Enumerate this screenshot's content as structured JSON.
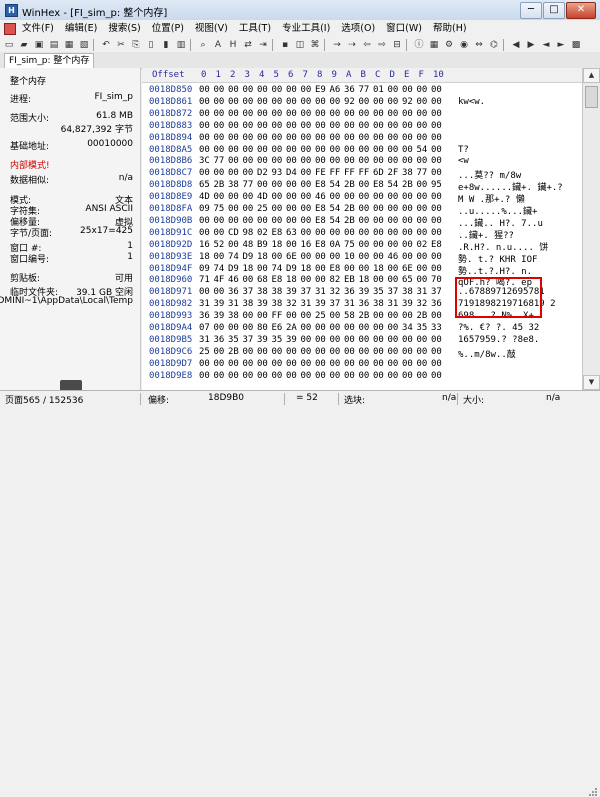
{
  "window": {
    "title": "WinHex - [FI_sim_p: 整个内存]",
    "app_icon": "H",
    "buttons": [
      "─",
      "□",
      "✕"
    ]
  },
  "menu": [
    "文件(F)",
    "编辑(E)",
    "搜索(S)",
    "位置(P)",
    "视图(V)",
    "工具(T)",
    "专业工具(I)",
    "选项(O)",
    "窗口(W)",
    "帮助(H)"
  ],
  "tabs": [
    "FI_sim_p: 整个内存"
  ],
  "panel": {
    "heading": "整个内存",
    "rows": [
      {
        "label": "进程:",
        "value": "FI_sim_p"
      },
      {
        "label": "范围大小:",
        "value": "61.8 MB"
      },
      {
        "label": "",
        "value": "64,827,392 字节"
      },
      {
        "label": "基础地址:",
        "value": "00010000"
      },
      {
        "label": "内部模式!",
        "value": ""
      },
      {
        "label": "数据相似:",
        "value": "n/a"
      },
      {
        "label": "模式:",
        "value": "文本"
      },
      {
        "label": "字符集:",
        "value": "ANSI ASCII"
      },
      {
        "label": "偏移量:",
        "value": "虚拟"
      },
      {
        "label": "字节/页面:",
        "value": "25x17=425"
      },
      {
        "label": "窗口 #:",
        "value": "1"
      },
      {
        "label": "窗口编号:",
        "value": "1"
      },
      {
        "label": "剪贴板:",
        "value": "可用"
      },
      {
        "label": "临时文件夹:",
        "value": "39.1 GB 空闲"
      },
      {
        "label": "",
        "value": "\\ADMINI~1\\AppData\\Local\\Temp"
      }
    ]
  },
  "hex": {
    "offset_label": "Offset",
    "columns": [
      "0",
      "1",
      "2",
      "3",
      "4",
      "5",
      "6",
      "7",
      "8",
      "9",
      "A",
      "B",
      "C",
      "D",
      "E",
      "F",
      "10"
    ],
    "rows": [
      {
        "offset": "0018D850",
        "bytes": [
          "00",
          "00",
          "00",
          "00",
          "00",
          "00",
          "00",
          "00",
          "E9",
          "A6",
          "36",
          "77",
          "01",
          "00",
          "00",
          "00",
          "00"
        ],
        "text": ""
      },
      {
        "offset": "0018D861",
        "bytes": [
          "00",
          "00",
          "00",
          "00",
          "00",
          "00",
          "00",
          "00",
          "00",
          "00",
          "92",
          "00",
          "00",
          "00",
          "92",
          "00",
          "00"
        ],
        "text": "   kw<w."
      },
      {
        "offset": "0018D872",
        "bytes": [
          "00",
          "00",
          "00",
          "00",
          "00",
          "00",
          "00",
          "00",
          "00",
          "00",
          "00",
          "00",
          "00",
          "00",
          "00",
          "00",
          "00"
        ],
        "text": ""
      },
      {
        "offset": "0018D883",
        "bytes": [
          "00",
          "00",
          "00",
          "00",
          "00",
          "00",
          "00",
          "00",
          "00",
          "00",
          "00",
          "00",
          "00",
          "00",
          "00",
          "00",
          "00"
        ],
        "text": ""
      },
      {
        "offset": "0018D894",
        "bytes": [
          "00",
          "00",
          "00",
          "00",
          "00",
          "00",
          "00",
          "00",
          "00",
          "00",
          "00",
          "00",
          "00",
          "00",
          "00",
          "00",
          "00"
        ],
        "text": ""
      },
      {
        "offset": "0018D8A5",
        "bytes": [
          "00",
          "00",
          "00",
          "00",
          "00",
          "00",
          "00",
          "00",
          "00",
          "00",
          "00",
          "00",
          "00",
          "00",
          "00",
          "54",
          "00"
        ],
        "text": "T?"
      },
      {
        "offset": "0018D8B6",
        "bytes": [
          "3C",
          "77",
          "00",
          "00",
          "00",
          "00",
          "00",
          "00",
          "00",
          "00",
          "00",
          "00",
          "00",
          "00",
          "00",
          "00",
          "00"
        ],
        "text": "<w"
      },
      {
        "offset": "0018D8C7",
        "bytes": [
          "00",
          "00",
          "00",
          "00",
          "D2",
          "93",
          "D4",
          "00",
          "FE",
          "FF",
          "FF",
          "FF",
          "6D",
          "2F",
          "38",
          "77",
          "00"
        ],
        "text": "...莫??     m/8w"
      },
      {
        "offset": "0018D8D8",
        "bytes": [
          "65",
          "2B",
          "38",
          "77",
          "00",
          "00",
          "00",
          "00",
          "E8",
          "54",
          "2B",
          "00",
          "E8",
          "54",
          "2B",
          "00",
          "95",
          "00"
        ],
        "text": "e+8w......鑶+. 鑶+.?"
      },
      {
        "offset": "0018D8E9",
        "bytes": [
          "4D",
          "00",
          "00",
          "00",
          "4D",
          "00",
          "00",
          "00",
          "46",
          "00",
          "00",
          "00",
          "00",
          "00",
          "00",
          "00",
          "00"
        ],
        "text": "M   W    .那+.? 懶"
      },
      {
        "offset": "0018D8FA",
        "bytes": [
          "09",
          "75",
          "00",
          "00",
          "25",
          "00",
          "00",
          "00",
          "E8",
          "54",
          "2B",
          "00",
          "00",
          "00",
          "00",
          "00",
          "00"
        ],
        "text": "..u.....%...鑶+"
      },
      {
        "offset": "0018D90B",
        "bytes": [
          "00",
          "00",
          "00",
          "00",
          "00",
          "00",
          "00",
          "00",
          "E8",
          "54",
          "2B",
          "00",
          "00",
          "00",
          "00",
          "00",
          "00"
        ],
        "text": "...鑶.. H?.  7..u"
      },
      {
        "offset": "0018D91C",
        "bytes": [
          "00",
          "00",
          "CD",
          "98",
          "02",
          "E8",
          "63",
          "00",
          "00",
          "00",
          "00",
          "00",
          "00",
          "00",
          "00",
          "00",
          "00"
        ],
        "text": "..鑶+. 猩??"
      },
      {
        "offset": "0018D92D",
        "bytes": [
          "16",
          "52",
          "00",
          "48",
          "B9",
          "18",
          "00",
          "16",
          "E8",
          "0A",
          "75",
          "00",
          "00",
          "00",
          "00",
          "02",
          "E8"
        ],
        "text": ".R.H?. n.u....   饼"
      },
      {
        "offset": "0018D93E",
        "bytes": [
          "18",
          "00",
          "74",
          "D9",
          "18",
          "00",
          "6E",
          "00",
          "00",
          "00",
          "10",
          "00",
          "00",
          "46",
          "00",
          "00",
          "00"
        ],
        "text": "勢.  t.?  KHR IOF"
      },
      {
        "offset": "0018D94F",
        "bytes": [
          "09",
          "74",
          "D9",
          "18",
          "00",
          "74",
          "D9",
          "18",
          "00",
          "E8",
          "00",
          "00",
          "18",
          "00",
          "6E",
          "00",
          "00"
        ],
        "text": "勢..t.?.H?. n."
      },
      {
        "offset": "0018D960",
        "bytes": [
          "71",
          "4F",
          "46",
          "00",
          "68",
          "E8",
          "18",
          "00",
          "00",
          "82",
          "EB",
          "18",
          "00",
          "00",
          "65",
          "00",
          "70"
        ],
        "text": "qOF.h?   喝?.  ep"
      },
      {
        "offset": "0018D971",
        "bytes": [
          "00",
          "00",
          "36",
          "37",
          "38",
          "38",
          "39",
          "37",
          "31",
          "32",
          "36",
          "39",
          "35",
          "37",
          "38",
          "31",
          "37"
        ],
        "text": "..67889712695781"
      },
      {
        "offset": "0018D982",
        "bytes": [
          "31",
          "39",
          "31",
          "38",
          "39",
          "38",
          "32",
          "31",
          "39",
          "37",
          "31",
          "36",
          "38",
          "31",
          "39",
          "32",
          "36"
        ],
        "text": "7191898219716819 2"
      },
      {
        "offset": "0018D993",
        "bytes": [
          "36",
          "39",
          "38",
          "00",
          "00",
          "FF",
          "00",
          "00",
          "25",
          "00",
          "58",
          "2B",
          "00",
          "00",
          "00",
          "2B",
          "00"
        ],
        "text": "698.  .?  N%. X+"
      },
      {
        "offset": "0018D9A4",
        "bytes": [
          "07",
          "00",
          "00",
          "00",
          "80",
          "E6",
          "2A",
          "00",
          "00",
          "00",
          "00",
          "00",
          "00",
          "00",
          "34",
          "35",
          "33"
        ],
        "text": "?%. €? ?. 45 32"
      },
      {
        "offset": "0018D9B5",
        "bytes": [
          "31",
          "36",
          "35",
          "37",
          "39",
          "35",
          "39",
          "00",
          "00",
          "00",
          "00",
          "00",
          "00",
          "00",
          "00",
          "00",
          "00"
        ],
        "text": "1657959.?  ?8e8."
      },
      {
        "offset": "0018D9C6",
        "bytes": [
          "25",
          "00",
          "2B",
          "00",
          "00",
          "00",
          "00",
          "00",
          "00",
          "00",
          "00",
          "00",
          "00",
          "00",
          "00",
          "00",
          "00"
        ],
        "text": "%..m/8w..敲"
      },
      {
        "offset": "0018D9D7",
        "bytes": [
          "00",
          "00",
          "00",
          "00",
          "00",
          "00",
          "00",
          "00",
          "00",
          "00",
          "00",
          "00",
          "00",
          "00",
          "00",
          "00",
          "00"
        ],
        "text": ""
      },
      {
        "offset": "0018D9E8",
        "bytes": [
          "00",
          "00",
          "00",
          "00",
          "00",
          "00",
          "00",
          "00",
          "00",
          "00",
          "00",
          "00",
          "00",
          "00",
          "00",
          "00",
          "00"
        ],
        "text": ""
      }
    ]
  },
  "status": {
    "page": "页面565 / 152536",
    "offset_label": "偏移:",
    "offset_value": "18D9B0",
    "eq": "= 52",
    "select_label": "选块:",
    "select_value": "n/a",
    "size_label": "大小:",
    "size_value": "n/a"
  },
  "colors": {
    "accent": "#1c3c9c",
    "highlight": "#e00000",
    "inner_mode": "#d00000"
  },
  "toolbar_icons": [
    "new-file",
    "open",
    "save",
    "print",
    "properties",
    "undo",
    "cut",
    "copy",
    "paste",
    "paste-special",
    "clone",
    "find",
    "find-hex",
    "replace",
    "goto",
    "ram",
    "disk",
    "cpu",
    "arrow-right",
    "arrow-left",
    "arrow-right2",
    "block",
    "info",
    "calc",
    "tools",
    "back",
    "forward",
    "play",
    "stop"
  ]
}
